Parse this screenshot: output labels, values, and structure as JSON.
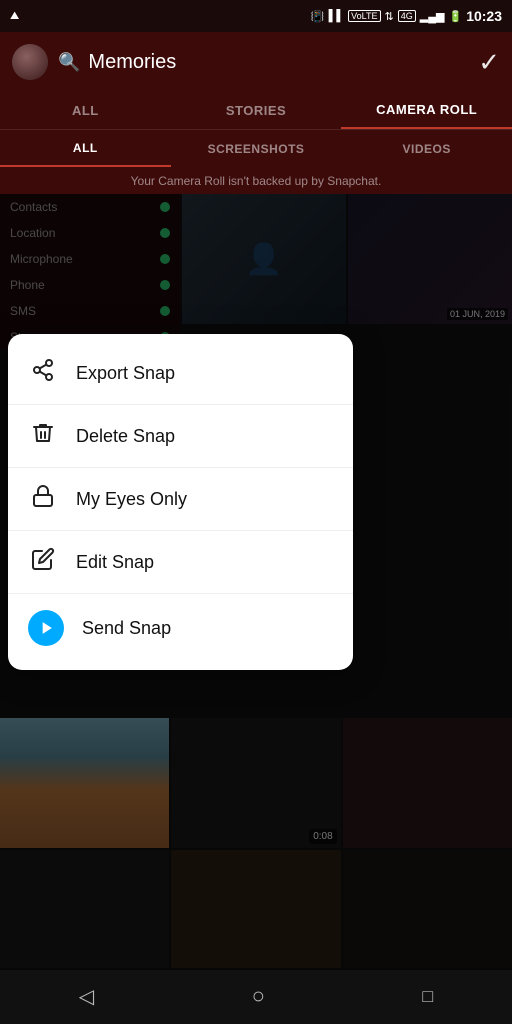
{
  "statusBar": {
    "time": "10:23",
    "icons": [
      "vibrate",
      "signal",
      "volte",
      "network-arrow",
      "4g",
      "signal-bars",
      "battery"
    ]
  },
  "topBar": {
    "title": "Memories",
    "checkIcon": "✓"
  },
  "tabs1": [
    {
      "label": "ALL",
      "active": false
    },
    {
      "label": "STORIES",
      "active": false
    },
    {
      "label": "CAMERA ROLL",
      "active": true
    }
  ],
  "tabs2": [
    {
      "label": "ALL",
      "active": true
    },
    {
      "label": "SCREENSHOTS",
      "active": false
    },
    {
      "label": "VIDEOS",
      "active": false
    }
  ],
  "backupMessage": "Your Camera Roll isn't backed up by Snapchat.",
  "permissions": [
    {
      "label": "Contacts"
    },
    {
      "label": "Location"
    },
    {
      "label": "Microphone"
    },
    {
      "label": "Phone"
    },
    {
      "label": "SMS"
    },
    {
      "label": "Storage"
    }
  ],
  "contextMenu": {
    "items": [
      {
        "id": "export",
        "label": "Export Snap",
        "iconType": "share"
      },
      {
        "id": "delete",
        "label": "Delete Snap",
        "iconType": "trash"
      },
      {
        "id": "eyes-only",
        "label": "My Eyes Only",
        "iconType": "lock"
      },
      {
        "id": "edit",
        "label": "Edit Snap",
        "iconType": "edit"
      },
      {
        "id": "send",
        "label": "Send Snap",
        "iconType": "send"
      }
    ]
  },
  "bottomGrid": {
    "cells": [
      {
        "type": "building",
        "hasVideo": false
      },
      {
        "type": "dark",
        "hasVideo": true,
        "videoDuration": "0:08"
      },
      {
        "type": "reddish",
        "hasVideo": false
      },
      {
        "type": "medium",
        "hasVideo": false
      },
      {
        "type": "warm",
        "hasVideo": false
      },
      {
        "type": "brownish",
        "hasVideo": false
      }
    ]
  },
  "bottomNav": {
    "back": "◁",
    "home": "○",
    "recent": "□"
  }
}
